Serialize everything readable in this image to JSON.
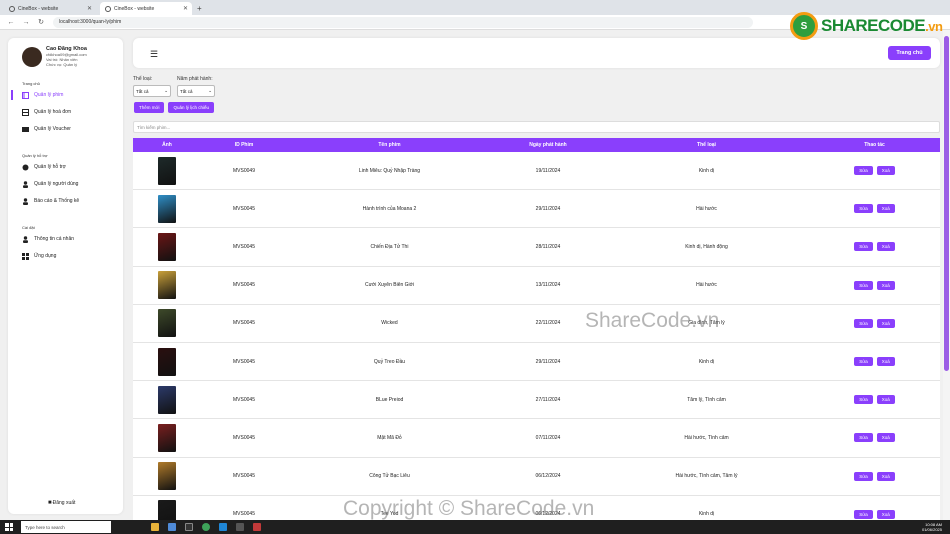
{
  "browser": {
    "tabs": [
      {
        "label": "CineBox - website",
        "active": false
      },
      {
        "label": "CineBox - website",
        "active": true
      }
    ],
    "new_tab": "+",
    "url": "localhost:3000/quan-ly/phim"
  },
  "watermark": {
    "logo_text": "SHARECODE",
    "logo_suffix": ".vn",
    "center": "ShareCode.vn",
    "bottom": "Copyright © ShareCode.vn"
  },
  "sidebar": {
    "user": {
      "name": "Cao Đăng Khoa",
      "email": "cfdkhoa09@gmail.com",
      "role": "Vai trò: Nhân viên",
      "position": "Chức vụ: Quản lý"
    },
    "sections": [
      {
        "title": "Trang chủ",
        "items": [
          {
            "label": "Quản lý phim",
            "icon": "film-icon",
            "active": true
          },
          {
            "label": "Quản lý hoá đơn",
            "icon": "table-icon",
            "active": false
          },
          {
            "label": "Quản lý Voucher",
            "icon": "ticket-icon",
            "active": false
          }
        ]
      },
      {
        "title": "Quản lý hỗ trợ",
        "items": [
          {
            "label": "Quản lý hỗ trợ",
            "icon": "chat-icon",
            "active": false
          },
          {
            "label": "Quản lý người dùng",
            "icon": "user-icon",
            "active": false
          },
          {
            "label": "Báo cáo & Thống kê",
            "icon": "report-icon",
            "active": false
          }
        ]
      },
      {
        "title": "Cài đặt",
        "items": [
          {
            "label": "Thông tin cá nhân",
            "icon": "profile-icon",
            "active": false
          },
          {
            "label": "Ứng dụng",
            "icon": "apps-icon",
            "active": false
          }
        ]
      }
    ],
    "logout": "Đăng xuất"
  },
  "header": {
    "home_button": "Trang chủ"
  },
  "filters": {
    "genre_label": "Thể loại:",
    "genre_value": "Tất cả",
    "year_label": "Năm phát hành:",
    "year_value": "Tất cả"
  },
  "actions": {
    "add_new": "Thêm mới",
    "manage_schedule": "Quản lý lịch chiếu"
  },
  "search": {
    "placeholder": "Tìm kiếm phim..."
  },
  "table": {
    "columns": [
      "Ảnh",
      "ID Phim",
      "Tên phim",
      "Ngày phát hành",
      "Thể loại",
      "Thao tác"
    ],
    "edit_label": "Sửa",
    "delete_label": "Xoá",
    "rows": [
      {
        "id": "MVS0049",
        "title": "Linh Miêu: Quỷ Nhập Tràng",
        "date": "19/11/2024",
        "genre": "Kinh dị",
        "poster_color": "#1e2a2a"
      },
      {
        "id": "MVS0045",
        "title": "Hành trình của Moana 2",
        "date": "29/11/2024",
        "genre": "Hài hước",
        "poster_color": "#2f8fc7"
      },
      {
        "id": "MVS0045",
        "title": "Chiến Địa Tử Thi",
        "date": "28/11/2024",
        "genre": "Kinh dị, Hành động",
        "poster_color": "#6b1616"
      },
      {
        "id": "MVS0045",
        "title": "Cưới Xuyên Biên Giới",
        "date": "13/11/2024",
        "genre": "Hài hước",
        "poster_color": "#c9a03a"
      },
      {
        "id": "MVS0045",
        "title": "Wicked",
        "date": "22/11/2024",
        "genre": "Gia đình, Tâm lý",
        "poster_color": "#3e4a2a"
      },
      {
        "id": "MVS0045",
        "title": "Quỷ Treo Đầu",
        "date": "29/11/2024",
        "genre": "Kinh dị",
        "poster_color": "#2a0f0f"
      },
      {
        "id": "MVS0045",
        "title": "BLue Preiod",
        "date": "27/11/2024",
        "genre": "Tâm lý, Tình cảm",
        "poster_color": "#2c3a6a"
      },
      {
        "id": "MVS0045",
        "title": "Mật Mã Đỏ",
        "date": "07/11/2024",
        "genre": "Hài hước, Tình cảm",
        "poster_color": "#7a1f1f"
      },
      {
        "id": "MVS0045",
        "title": "Công Tử Bạc Liêu",
        "date": "06/12/2024",
        "genre": "Hài hước, Tình cảm, Tâm lý",
        "poster_color": "#b07b2a"
      },
      {
        "id": "MVS0045",
        "title": "Tee Yod",
        "date": "06/12/2024",
        "genre": "Kinh dị",
        "poster_color": "#1a1a1a"
      }
    ]
  },
  "taskbar": {
    "search_placeholder": "Type here to search",
    "time": "10:08 AM",
    "date": "01/06/2025"
  }
}
